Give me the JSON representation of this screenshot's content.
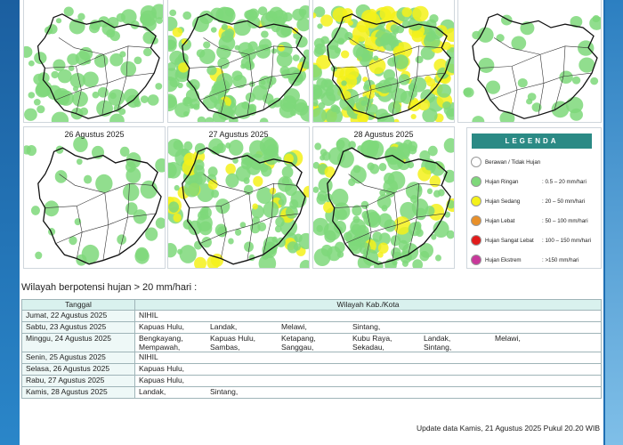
{
  "maps": [
    {
      "date": "",
      "rain": "light-sparse"
    },
    {
      "date": "",
      "rain": "light-moderate"
    },
    {
      "date": "",
      "rain": "moderate-heavy"
    },
    {
      "date": "",
      "rain": "sparse"
    },
    {
      "date": "26 Agustus 2025",
      "rain": "sparse"
    },
    {
      "date": "27 Agustus 2025",
      "rain": "moderate"
    },
    {
      "date": "28 Agustus 2025",
      "rain": "light-moderate"
    }
  ],
  "legend": {
    "title": "LEGENDA",
    "items": [
      {
        "label": "Berawan / Tidak Hujan",
        "range": "",
        "color": "#ffffff"
      },
      {
        "label": "Hujan Ringan",
        "range": ": 0.5 – 20 mm/hari",
        "color": "#7ed87a"
      },
      {
        "label": "Hujan Sedang",
        "range": ": 20 – 50 mm/hari",
        "color": "#f4f11a"
      },
      {
        "label": "Hujan Lebat",
        "range": ": 50 – 100 mm/hari",
        "color": "#e8902a"
      },
      {
        "label": "Hujan Sangat Lebat",
        "range": ": 100 – 150 mm/hari",
        "color": "#e11b1b"
      },
      {
        "label": "Hujan Ekstrem",
        "range": ": >150 mm/hari",
        "color": "#c8389a"
      }
    ]
  },
  "heading": "Wilayah berpotensi hujan > 20 mm/hari :",
  "table": {
    "col_date": "Tanggal",
    "col_region": "Wilayah Kab./Kota",
    "rows": [
      {
        "date": "Jumat, 22 Agustus 2025",
        "regions": [
          "NIHIL"
        ]
      },
      {
        "date": "Sabtu, 23 Agustus 2025",
        "regions": [
          "Kapuas Hulu,",
          "Landak,",
          "Melawi,",
          "Sintang,"
        ]
      },
      {
        "date": "Minggu, 24 Agustus 2025",
        "regions": [
          "Bengkayang,",
          "Kapuas Hulu,",
          "Ketapang,",
          "Kubu Raya,",
          "Landak,",
          "Melawi,",
          "Mempawah,",
          "Sambas,",
          "Sanggau,",
          "Sekadau,",
          "Sintang,"
        ]
      },
      {
        "date": "Senin, 25 Agustus 2025",
        "regions": [
          "NIHIL"
        ]
      },
      {
        "date": "Selasa, 26 Agustus 2025",
        "regions": [
          "Kapuas Hulu,"
        ]
      },
      {
        "date": "Rabu, 27 Agustus 2025",
        "regions": [
          "Kapuas Hulu,"
        ]
      },
      {
        "date": "Kamis, 28 Agustus 2025",
        "regions": [
          "Landak,",
          "Sintang,"
        ]
      }
    ]
  },
  "update": "Update data Kamis, 21 Agustus 2025 Pukul 20.20 WIB"
}
